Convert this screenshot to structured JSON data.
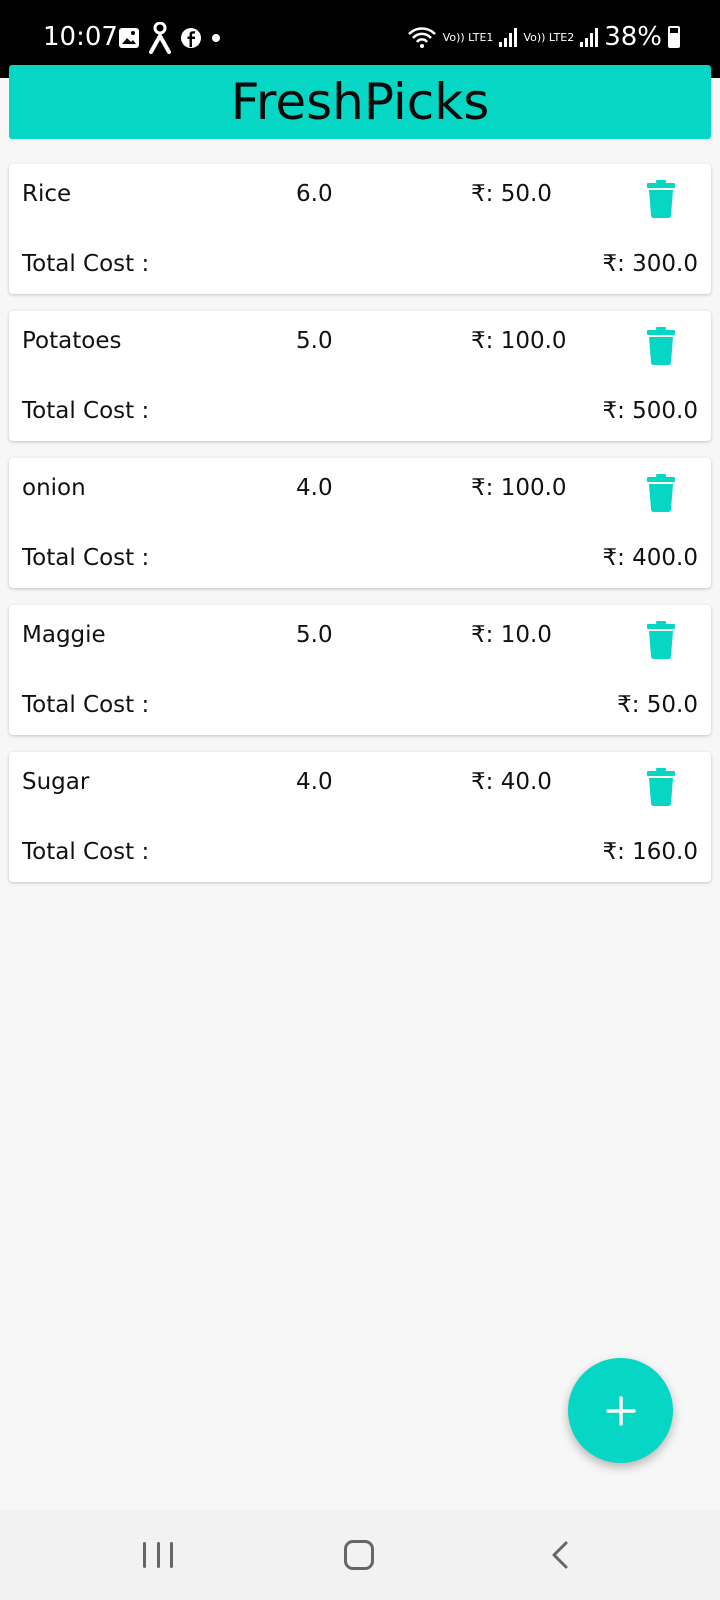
{
  "status_bar": {
    "time": "10:07",
    "network1": "Vo)) LTE1",
    "network2": "Vo)) LTE2",
    "battery": "38%",
    "icons": [
      "gallery-icon",
      "accessibility-icon",
      "facebook-icon",
      "dot-icon",
      "wifi-icon",
      "signal-icon",
      "battery-icon"
    ]
  },
  "header": {
    "title": "FreshPicks"
  },
  "colors": {
    "accent": "#06d6c4",
    "background": "#f7f7f7",
    "card": "#ffffff"
  },
  "items": [
    {
      "name": "Rice",
      "quantity": "6.0",
      "price": "₹: 50.0",
      "total_label": "Total Cost :",
      "total": "₹: 300.0"
    },
    {
      "name": "Potatoes",
      "quantity": "5.0",
      "price": "₹: 100.0",
      "total_label": "Total Cost :",
      "total": "₹: 500.0"
    },
    {
      "name": "onion",
      "quantity": "4.0",
      "price": "₹: 100.0",
      "total_label": "Total Cost :",
      "total": "₹: 400.0"
    },
    {
      "name": "Maggie",
      "quantity": "5.0",
      "price": "₹: 10.0",
      "total_label": "Total Cost :",
      "total": "₹: 50.0"
    },
    {
      "name": "Sugar",
      "quantity": "4.0",
      "price": "₹: 40.0",
      "total_label": "Total Cost :",
      "total": "₹: 160.0"
    }
  ],
  "fab": {
    "icon": "plus-icon"
  },
  "nav_bar": {
    "icons": [
      "recents-icon",
      "home-icon",
      "back-icon"
    ]
  }
}
